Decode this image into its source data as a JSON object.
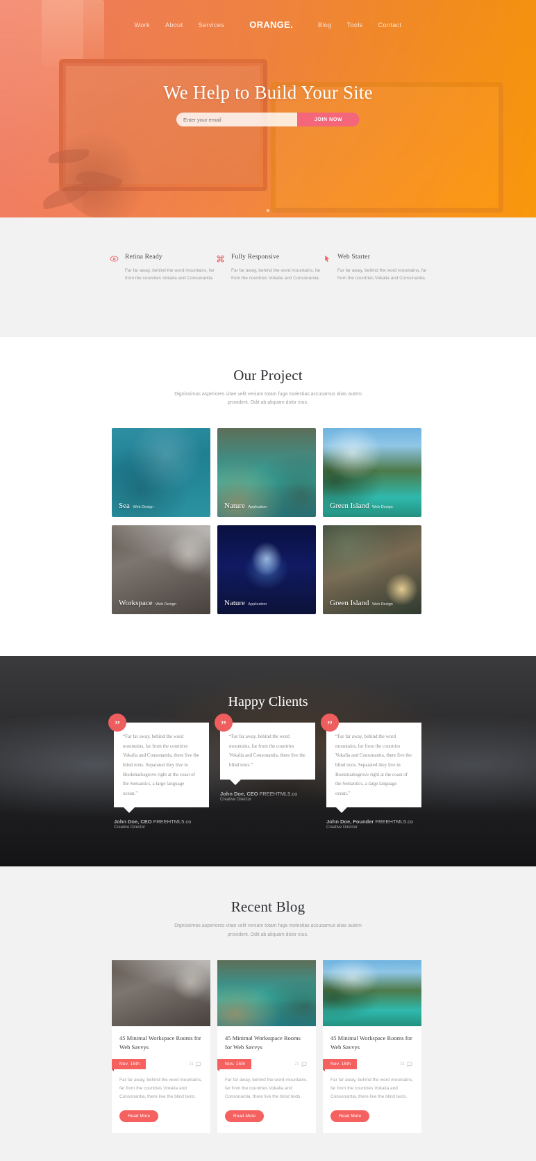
{
  "nav": {
    "brand": "ORANGE.",
    "left": [
      {
        "label": "Work"
      },
      {
        "label": "About"
      },
      {
        "label": "Services"
      }
    ],
    "right": [
      {
        "label": "Blog"
      },
      {
        "label": "Tools"
      },
      {
        "label": "Contact"
      }
    ]
  },
  "hero": {
    "title": "We Help to Build Your Site",
    "email_placeholder": "Enter your email",
    "email_value": "",
    "cta_label": "JOIN NOW"
  },
  "features": [
    {
      "icon": "eye-icon",
      "title": "Retina Ready",
      "text": "Far far away, behind the word mountains, far from the countries Vokalia and Consonantia."
    },
    {
      "icon": "command-icon",
      "title": "Fully Responsive",
      "text": "Far far away, behind the word mountains, far from the countries Vokalia and Consonantia."
    },
    {
      "icon": "mouse-icon",
      "title": "Web Starter",
      "text": "Far far away, behind the word mountains, far from the countries Vokalia and Consonantia."
    }
  ],
  "projects": {
    "title": "Our Project",
    "subtitle": "Dignissimos asperiores vitae velit veniam totam fuga molestias accusamus alias autem provident. Odit ab aliquam dolor eius.",
    "items": [
      {
        "title": "Sea",
        "category": "Web Design",
        "theme": "ph-sea"
      },
      {
        "title": "Nature",
        "category": "Application",
        "theme": "ph-nature1"
      },
      {
        "title": "Green Island",
        "category": "Web Design",
        "theme": "ph-green1"
      },
      {
        "title": "Workspace",
        "category": "Web Design",
        "theme": "ph-work"
      },
      {
        "title": "Nature",
        "category": "Application",
        "theme": "ph-nature2"
      },
      {
        "title": "Green Island",
        "category": "Web Design",
        "theme": "ph-green2"
      }
    ]
  },
  "clients": {
    "title": "Happy Clients",
    "items": [
      {
        "quote": "“Far far away, behind the word mountains, far from the countries Vokalia and Consonantia, there live the blind texts. Separated they live in Bookmarksgrove right at the coast of the Semantics, a large language ocean.”",
        "name": "John Doe, CEO",
        "company": "FREEHTML5.co",
        "role": "Creative Director",
        "quote_mark": "”"
      },
      {
        "quote": "“Far far away, behind the word mountains, far from the countries Vokalia and Consonantia, there live the blind texts.”",
        "name": "John Doe, CEO",
        "company": "FREEHTML5.co",
        "role": "Creative Director",
        "quote_mark": "”"
      },
      {
        "quote": "“Far far away, behind the word mountains, far from the countries Vokalia and Consonantia, there live the blind texts. Separated they live in Bookmarksgrove right at the coast of the Semantics, a large language ocean.”",
        "name": "John Doe, Founder",
        "company": "FREEHTML5.co",
        "role": "Creative Director",
        "quote_mark": "”"
      }
    ]
  },
  "blog": {
    "title": "Recent Blog",
    "subtitle": "Dignissimos asperiores vitae velit veniam totam fuga molestias accusamus alias autem provident. Odit ab aliquam dolor eius.",
    "posts": [
      {
        "title": "45 Minimal Workspace Rooms for Web Savvys",
        "date": "Nov. 15th",
        "comments": "21",
        "excerpt": "Far far away, behind the word mountains, far from the countries Vokalia and Consonantia, there live the blind texts.",
        "read_more": "Read More",
        "theme": "bh-work"
      },
      {
        "title": "45 Minimal Worksspace Rooms for Web Savvys",
        "date": "Nov. 15th",
        "comments": "21",
        "excerpt": "Far far away, behind the word mountains, far from the countries Vokalia and Consonantia, there live the blind texts.",
        "read_more": "Read More",
        "theme": "bh-nature"
      },
      {
        "title": "45 Minimal Workspace Rooms for Web Savvys",
        "date": "Nov. 15th",
        "comments": "21",
        "excerpt": "Far far away, behind the word mountains, far from the countries Vokalia and Consonantia, there live the blind texts.",
        "read_more": "Read More",
        "theme": "bh-green"
      }
    ]
  },
  "colors": {
    "accent_orange": "#ff9600",
    "accent_coral": "#f4615f",
    "accent_pink": "#f4677a",
    "feature_icon": "#ef5e61"
  }
}
